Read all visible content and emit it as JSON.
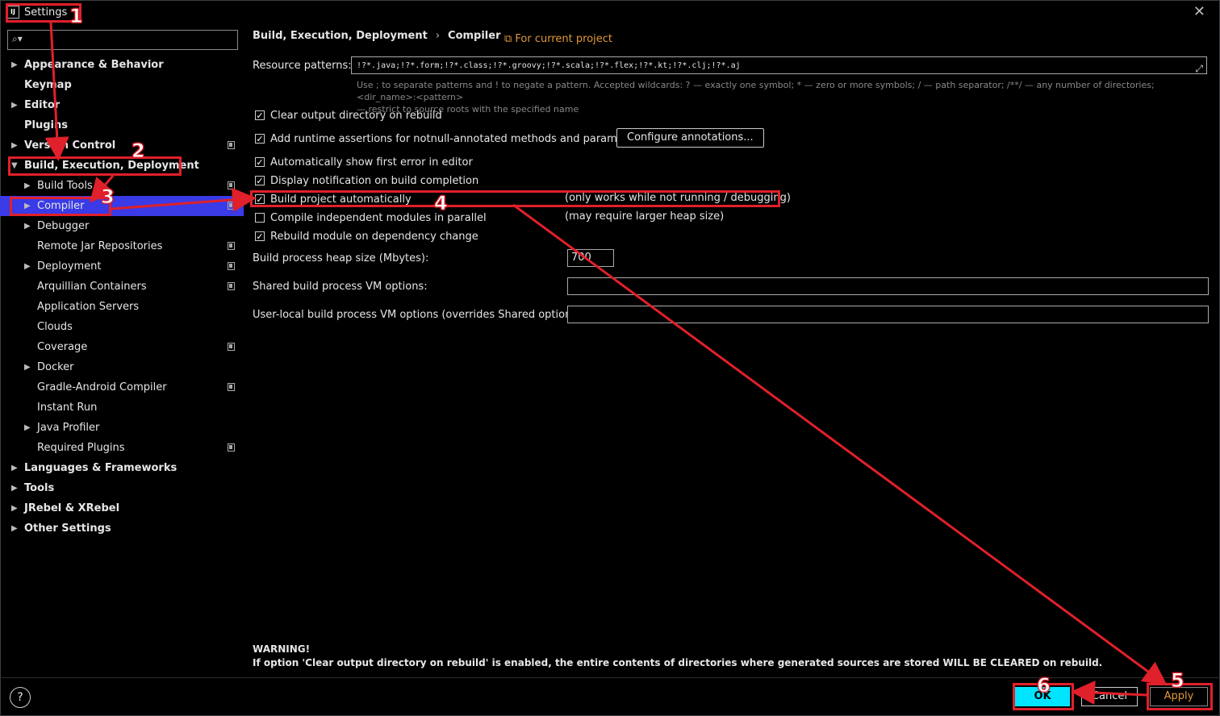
{
  "window": {
    "title": "Settings",
    "app_icon": "IJ"
  },
  "sidebar": {
    "search_placeholder": "",
    "items": [
      {
        "label": "Appearance & Behavior",
        "bold": true,
        "level": 0,
        "arrow": "right",
        "copy": false
      },
      {
        "label": "Keymap",
        "bold": true,
        "level": 0,
        "arrow": "",
        "copy": false
      },
      {
        "label": "Editor",
        "bold": true,
        "level": 0,
        "arrow": "right",
        "copy": false
      },
      {
        "label": "Plugins",
        "bold": true,
        "level": 0,
        "arrow": "",
        "copy": false
      },
      {
        "label": "Version Control",
        "bold": true,
        "level": 0,
        "arrow": "right",
        "copy": true
      },
      {
        "label": "Build, Execution, Deployment",
        "bold": true,
        "level": 0,
        "arrow": "down",
        "copy": false
      },
      {
        "label": "Build Tools",
        "bold": false,
        "level": 1,
        "arrow": "right",
        "copy": true
      },
      {
        "label": "Compiler",
        "bold": false,
        "level": 1,
        "arrow": "right",
        "copy": true,
        "selected": true
      },
      {
        "label": "Debugger",
        "bold": false,
        "level": 1,
        "arrow": "right",
        "copy": false
      },
      {
        "label": "Remote Jar Repositories",
        "bold": false,
        "level": 1,
        "arrow": "",
        "copy": true
      },
      {
        "label": "Deployment",
        "bold": false,
        "level": 1,
        "arrow": "right",
        "copy": true
      },
      {
        "label": "Arquillian Containers",
        "bold": false,
        "level": 1,
        "arrow": "",
        "copy": true
      },
      {
        "label": "Application Servers",
        "bold": false,
        "level": 1,
        "arrow": "",
        "copy": false
      },
      {
        "label": "Clouds",
        "bold": false,
        "level": 1,
        "arrow": "",
        "copy": false
      },
      {
        "label": "Coverage",
        "bold": false,
        "level": 1,
        "arrow": "",
        "copy": true
      },
      {
        "label": "Docker",
        "bold": false,
        "level": 1,
        "arrow": "right",
        "copy": false
      },
      {
        "label": "Gradle-Android Compiler",
        "bold": false,
        "level": 1,
        "arrow": "",
        "copy": true
      },
      {
        "label": "Instant Run",
        "bold": false,
        "level": 1,
        "arrow": "",
        "copy": false
      },
      {
        "label": "Java Profiler",
        "bold": false,
        "level": 1,
        "arrow": "right",
        "copy": false
      },
      {
        "label": "Required Plugins",
        "bold": false,
        "level": 1,
        "arrow": "",
        "copy": true
      },
      {
        "label": "Languages & Frameworks",
        "bold": true,
        "level": 0,
        "arrow": "right",
        "copy": false
      },
      {
        "label": "Tools",
        "bold": true,
        "level": 0,
        "arrow": "right",
        "copy": false
      },
      {
        "label": "JRebel & XRebel",
        "bold": true,
        "level": 0,
        "arrow": "right",
        "copy": false
      },
      {
        "label": "Other Settings",
        "bold": true,
        "level": 0,
        "arrow": "right",
        "copy": false
      }
    ]
  },
  "breadcrumb": {
    "parent": "Build, Execution, Deployment",
    "separator": "›",
    "current": "Compiler",
    "scope": "For current project"
  },
  "resource_patterns": {
    "label": "Resource patterns:",
    "value": "!?*.java;!?*.form;!?*.class;!?*.groovy;!?*.scala;!?*.flex;!?*.kt;!?*.clj;!?*.aj",
    "hint_line1": "Use ; to separate patterns and ! to negate a pattern. Accepted wildcards: ? — exactly one symbol; * — zero or more symbols; / — path separator; /**/ — any number of directories; <dir_name>:<pattern>",
    "hint_line2": "— restrict to source roots with the specified name"
  },
  "options": [
    {
      "label": "Clear output directory on rebuild",
      "checked": true
    },
    {
      "label": "Add runtime assertions for notnull-annotated methods and parameters",
      "checked": true
    },
    {
      "label": "Automatically show first error in editor",
      "checked": true
    },
    {
      "label": "Display notification on build completion",
      "checked": true
    },
    {
      "label": "Build project automatically",
      "checked": true,
      "note": "(only works while not running / debugging)"
    },
    {
      "label": "Compile independent modules in parallel",
      "checked": false,
      "note": "(may require larger heap size)"
    },
    {
      "label": "Rebuild module on dependency change",
      "checked": true
    }
  ],
  "configure_button": "Configure annotations...",
  "heap": {
    "label": "Build process heap size (Mbytes):",
    "value": "700"
  },
  "shared_vm": {
    "label": "Shared build process VM options:",
    "value": ""
  },
  "user_vm": {
    "label": "User-local build process VM options (overrides Shared options):",
    "value": ""
  },
  "warning": {
    "title": "WARNING!",
    "text": "If option 'Clear output directory on rebuild' is enabled, the entire contents of directories where generated sources are stored WILL BE CLEARED on rebuild."
  },
  "buttons": {
    "help": "?",
    "ok": "OK",
    "cancel": "Cancel",
    "apply": "Apply"
  },
  "annotations": [
    "1",
    "2",
    "3",
    "4",
    "5",
    "6"
  ],
  "colors": {
    "selection": "#3a3ae6",
    "accent_orange": "#e09a3a",
    "ok_button": "#00e5ff",
    "annotation_red": "#e0202a"
  }
}
